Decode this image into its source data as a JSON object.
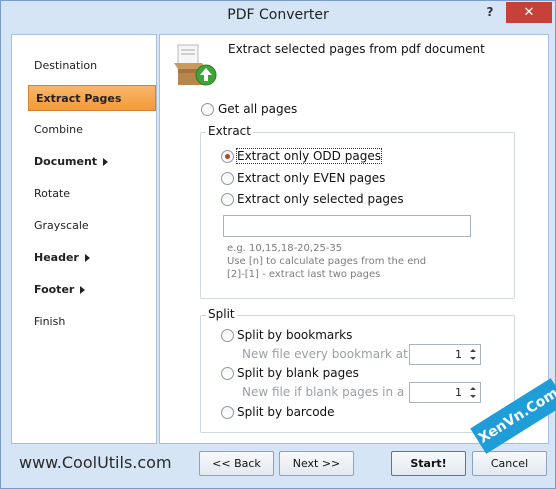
{
  "window": {
    "title": "PDF Converter",
    "help_label": "?",
    "close_label": "✕"
  },
  "sidebar": {
    "items": [
      {
        "label": "Destination"
      },
      {
        "label": "Extract Pages"
      },
      {
        "label": "Combine"
      },
      {
        "label": "Document"
      },
      {
        "label": "Rotate"
      },
      {
        "label": "Grayscale"
      },
      {
        "label": "Header"
      },
      {
        "label": "Footer"
      },
      {
        "label": "Finish"
      }
    ]
  },
  "content": {
    "header_text": "Extract selected pages from pdf document",
    "get_all_pages": "Get all pages",
    "extract_group": {
      "title": "Extract",
      "options": [
        {
          "label": "Extract only ODD pages",
          "checked": true
        },
        {
          "label": "Extract only EVEN pages",
          "checked": false
        },
        {
          "label": "Extract only selected pages",
          "checked": false
        }
      ],
      "pages_input_value": "",
      "hint_lines": [
        "e.g. 10,15,18-20,25-35",
        "Use [n] to calculate pages from the end",
        "[2]-[1] - extract last two pages"
      ]
    },
    "split_group": {
      "title": "Split",
      "by_bookmarks": "Split by bookmarks",
      "bookmark_hint": "New file every bookmark at le",
      "bookmark_value": "1",
      "by_blank": "Split by blank pages",
      "blank_hint": "New file if blank pages in a ro",
      "blank_value": "1",
      "by_barcode": "Split by barcode"
    }
  },
  "footer": {
    "link": "www.CoolUtils.com",
    "back": "<< Back",
    "next": "Next >>",
    "start": "Start!",
    "cancel": "Cancel"
  },
  "watermark": "XenVn.Com",
  "colors": {
    "accent_selected": "#f39a38",
    "close_button": "#c7413b",
    "radio_dot": "#b5451b"
  }
}
